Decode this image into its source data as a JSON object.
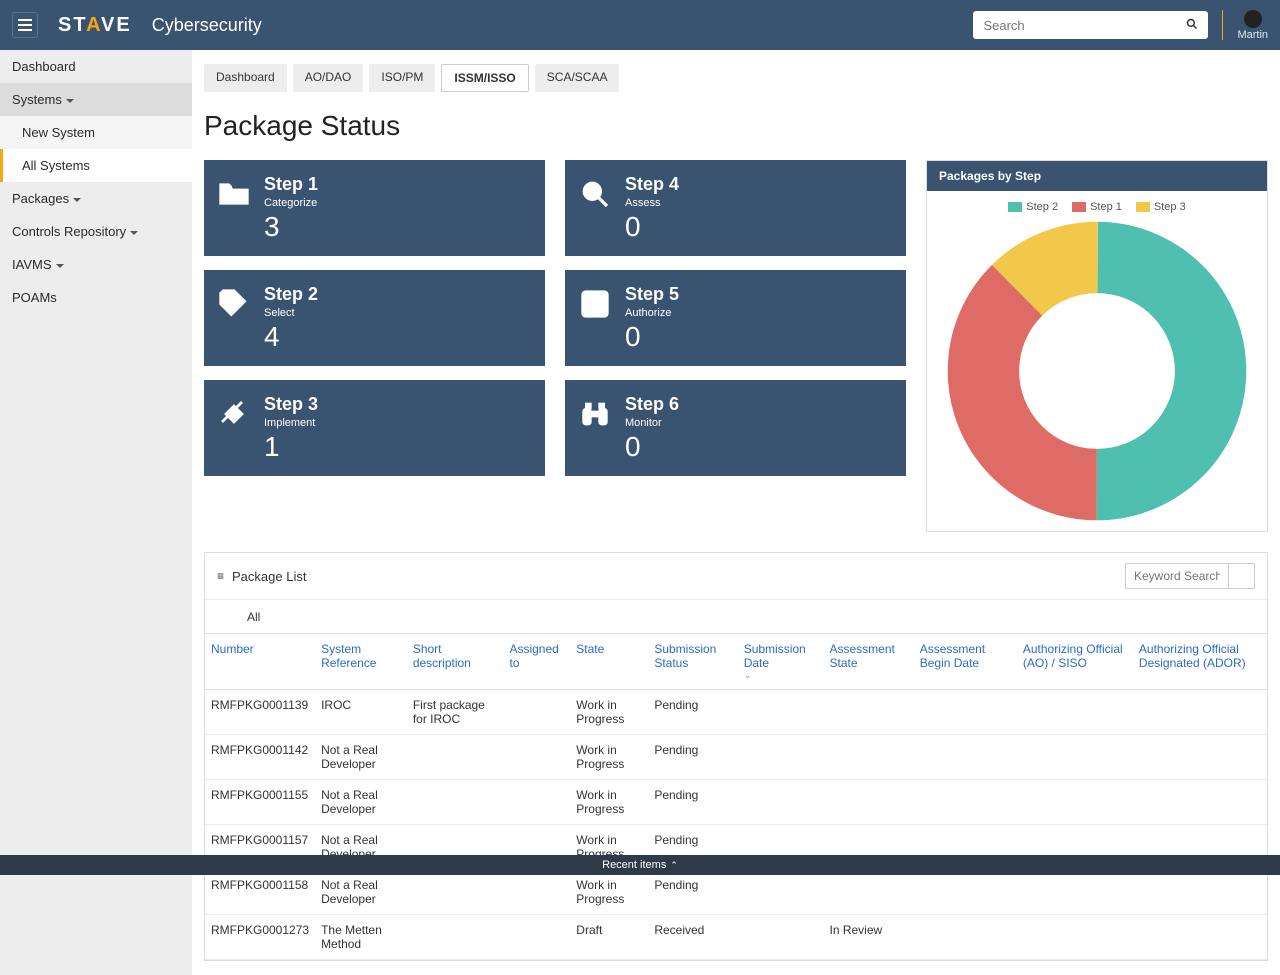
{
  "header": {
    "logo_pre": "ST",
    "logo_mid": "A",
    "logo_post": "VE",
    "app_name": "Cybersecurity",
    "search_placeholder": "Search",
    "user_name": "Martin"
  },
  "sidebar": {
    "dashboard": "Dashboard",
    "systems": "Systems",
    "new_system": "New System",
    "all_systems": "All Systems",
    "packages": "Packages",
    "controls": "Controls Repository",
    "iavms": "IAVMS",
    "poams": "POAMs"
  },
  "tabs": {
    "dashboard": "Dashboard",
    "ao": "AO/DAO",
    "iso": "ISO/PM",
    "issm": "ISSM/ISSO",
    "sca": "SCA/SCAA"
  },
  "page_title": "Package Status",
  "steps": [
    {
      "title": "Step 1",
      "sub": "Categorize",
      "num": "3"
    },
    {
      "title": "Step 2",
      "sub": "Select",
      "num": "4"
    },
    {
      "title": "Step 3",
      "sub": "Implement",
      "num": "1"
    },
    {
      "title": "Step 4",
      "sub": "Assess",
      "num": "0"
    },
    {
      "title": "Step 5",
      "sub": "Authorize",
      "num": "0"
    },
    {
      "title": "Step 6",
      "sub": "Monitor",
      "num": "0"
    }
  ],
  "chart": {
    "title": "Packages by Step",
    "legend": [
      "Step 2",
      "Step 1",
      "Step 3"
    ],
    "colors": {
      "step1": "#df6b67",
      "step2": "#4fbfb0",
      "step3": "#f2c84b"
    }
  },
  "chart_data": {
    "type": "pie",
    "title": "Packages by Step",
    "series": [
      {
        "name": "Step 2",
        "value": 4
      },
      {
        "name": "Step 1",
        "value": 3
      },
      {
        "name": "Step 3",
        "value": 1
      }
    ]
  },
  "list": {
    "title": "Package List",
    "keyword_placeholder": "Keyword Search",
    "filter_all": "All",
    "columns": {
      "number": "Number",
      "sysref": "System Reference",
      "shortdesc": "Short description",
      "assigned": "Assigned to",
      "state": "State",
      "substatus": "Submission Status",
      "subdate": "Submission Date",
      "assess_state": "Assessment State",
      "assess_begin": "Assessment Begin Date",
      "ao": "Authorizing Official (AO) / SISO",
      "ador": "Authorizing Official Designated (ADOR)"
    },
    "rows": [
      {
        "number": "RMFPKG0001139",
        "sysref": "IROC",
        "shortdesc": "First package for IROC",
        "assigned": "",
        "state": "Work in Progress",
        "substatus": "Pending",
        "subdate": "",
        "assess_state": "",
        "assess_begin": "",
        "ao": "",
        "ador": ""
      },
      {
        "number": "RMFPKG0001142",
        "sysref": "Not a Real Developer",
        "shortdesc": "",
        "assigned": "",
        "state": "Work in Progress",
        "substatus": "Pending",
        "subdate": "",
        "assess_state": "",
        "assess_begin": "",
        "ao": "",
        "ador": ""
      },
      {
        "number": "RMFPKG0001155",
        "sysref": "Not a Real Developer",
        "shortdesc": "",
        "assigned": "",
        "state": "Work in Progress",
        "substatus": "Pending",
        "subdate": "",
        "assess_state": "",
        "assess_begin": "",
        "ao": "",
        "ador": ""
      },
      {
        "number": "RMFPKG0001157",
        "sysref": "Not a Real Developer",
        "shortdesc": "",
        "assigned": "",
        "state": "Work in Progress",
        "substatus": "Pending",
        "subdate": "",
        "assess_state": "",
        "assess_begin": "",
        "ao": "",
        "ador": ""
      },
      {
        "number": "RMFPKG0001158",
        "sysref": "Not a Real Developer",
        "shortdesc": "",
        "assigned": "",
        "state": "Work in Progress",
        "substatus": "Pending",
        "subdate": "",
        "assess_state": "",
        "assess_begin": "",
        "ao": "",
        "ador": ""
      },
      {
        "number": "RMFPKG0001273",
        "sysref": "The Metten Method",
        "shortdesc": "",
        "assigned": "",
        "state": "Draft",
        "substatus": "Received",
        "subdate": "",
        "assess_state": "In Review",
        "assess_begin": "",
        "ao": "",
        "ador": ""
      }
    ]
  },
  "footer": "Recent items"
}
